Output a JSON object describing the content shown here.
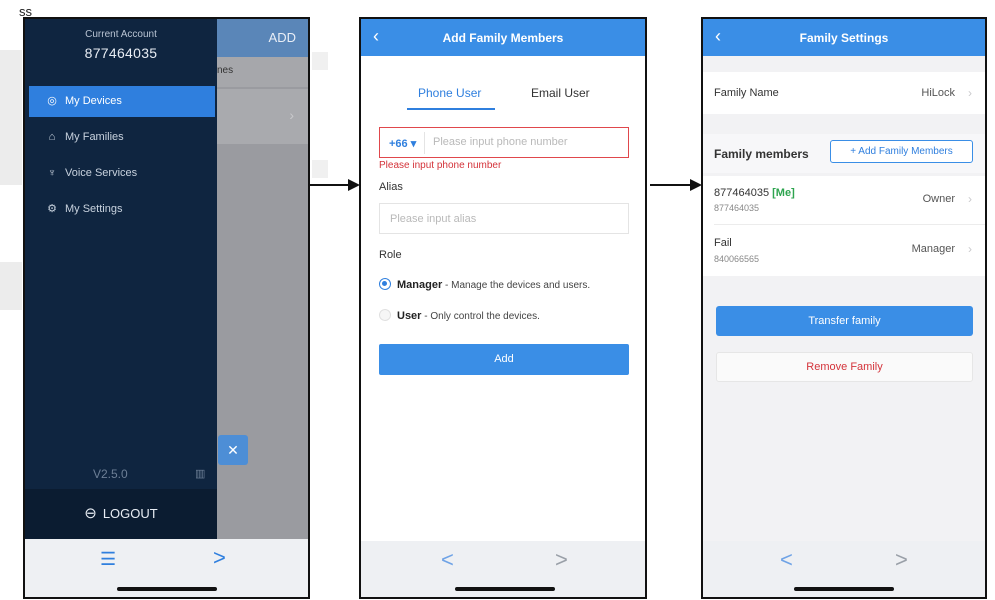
{
  "corner_text": "ss",
  "screen1": {
    "account_label": "Current Account",
    "account_id": "877464035",
    "background_add_label": "ADD",
    "background_tab_text": "nes",
    "menu": [
      {
        "label": "My Devices",
        "icon": "devices-icon",
        "active": true
      },
      {
        "label": "My Families",
        "icon": "home-icon",
        "active": false
      },
      {
        "label": "Voice Services",
        "icon": "microphone-icon",
        "active": false
      },
      {
        "label": "My Settings",
        "icon": "gear-icon",
        "active": false
      }
    ],
    "version": "V2.5.0",
    "logout_label": "LOGOUT"
  },
  "screen2": {
    "title": "Add Family Members",
    "tabs": [
      {
        "label": "Phone User",
        "active": true
      },
      {
        "label": "Email User",
        "active": false
      }
    ],
    "country_code": "+66",
    "phone_placeholder": "Please input phone number",
    "phone_error": "Please input phone number",
    "alias_label": "Alias",
    "alias_placeholder": "Please input alias",
    "role_label": "Role",
    "roles": [
      {
        "name": "Manager",
        "description": " - Manage the devices and users.",
        "selected": true
      },
      {
        "name": "User",
        "description": " - Only control the devices.",
        "selected": false
      }
    ],
    "add_button": "Add"
  },
  "screen3": {
    "title": "Family Settings",
    "family_name_label": "Family Name",
    "family_name_value": "HiLock",
    "members_heading": "Family members",
    "add_members_button": "Add Family Members",
    "members": [
      {
        "name": "877464035",
        "tag": "[Me]",
        "sub": "877464035",
        "role": "Owner"
      },
      {
        "name": "Fail",
        "tag": "",
        "sub": "840066565",
        "role": "Manager"
      }
    ],
    "transfer_button": "Transfer family",
    "remove_button": "Remove Family"
  },
  "colors": {
    "accent": "#3a8ee6",
    "drawer_bg": "#0f2540",
    "error": "#d4333a",
    "me_tag": "#2ea44f"
  }
}
